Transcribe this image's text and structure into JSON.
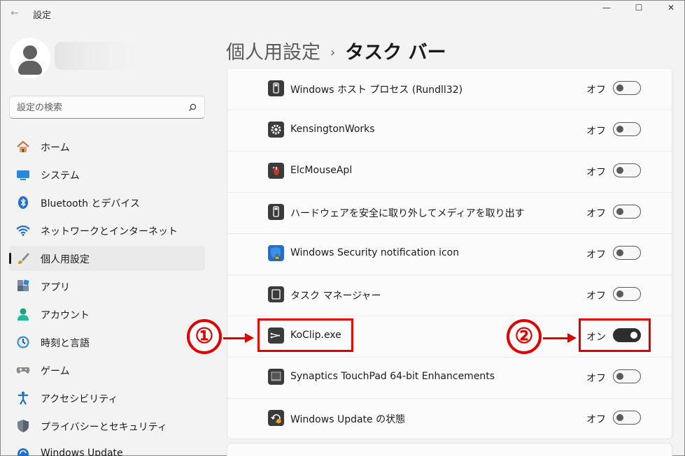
{
  "window": {
    "title": "設定",
    "back": "←",
    "minimize": "—",
    "maximize": "☐",
    "close": "✕"
  },
  "search": {
    "placeholder": "設定の検索"
  },
  "breadcrumb": {
    "parent": "個人用設定",
    "separator": "›",
    "current": "タスク バー"
  },
  "nav": [
    {
      "label": "ホーム",
      "icon": "home-icon"
    },
    {
      "label": "システム",
      "icon": "system-icon"
    },
    {
      "label": "Bluetooth とデバイス",
      "icon": "bluetooth-icon"
    },
    {
      "label": "ネットワークとインターネット",
      "icon": "wifi-icon"
    },
    {
      "label": "個人用設定",
      "icon": "brush-icon",
      "active": true
    },
    {
      "label": "アプリ",
      "icon": "apps-icon"
    },
    {
      "label": "アカウント",
      "icon": "account-icon"
    },
    {
      "label": "時刻と言語",
      "icon": "time-language-icon"
    },
    {
      "label": "ゲーム",
      "icon": "gamepad-icon"
    },
    {
      "label": "アクセシビリティ",
      "icon": "accessibility-icon"
    },
    {
      "label": "プライバシーとセキュリティ",
      "icon": "shield-icon"
    },
    {
      "label": "Windows Update",
      "icon": "windows-update-icon"
    }
  ],
  "apps": [
    {
      "name": "Windows ホスト プロセス (Rundll32)",
      "state": "オフ",
      "on": false,
      "icon": "usb-drive-icon"
    },
    {
      "name": "KensingtonWorks",
      "state": "オフ",
      "on": false,
      "icon": "gear-icon"
    },
    {
      "name": "ElcMouseApl",
      "state": "オフ",
      "on": false,
      "icon": "mouse-icon"
    },
    {
      "name": "ハードウェアを安全に取り外してメディアを取り出す",
      "state": "オフ",
      "on": false,
      "icon": "usb-drive-icon"
    },
    {
      "name": "Windows Security notification icon",
      "state": "オフ",
      "on": false,
      "icon": "security-warning-icon"
    },
    {
      "name": "タスク マネージャー",
      "state": "オフ",
      "on": false,
      "icon": "task-manager-icon"
    },
    {
      "name": "KoClip.exe",
      "state": "オン",
      "on": true,
      "icon": "scissors-icon"
    },
    {
      "name": "Synaptics TouchPad 64-bit Enhancements",
      "state": "オフ",
      "on": false,
      "icon": "touchpad-icon"
    },
    {
      "name": "Windows Update の状態",
      "state": "オフ",
      "on": false,
      "icon": "update-icon"
    }
  ],
  "annotations": {
    "one": "①",
    "two": "②",
    "color": "#e00000"
  }
}
